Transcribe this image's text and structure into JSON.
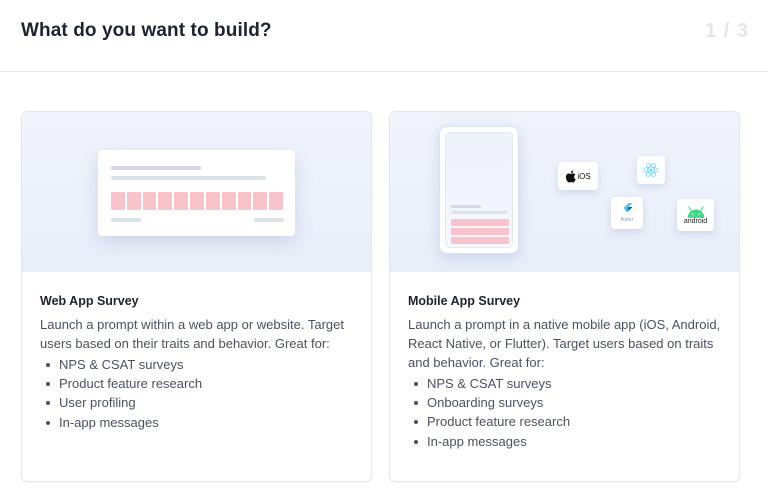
{
  "header": {
    "title": "What do you want to build?",
    "step": "1 / 3"
  },
  "cards": [
    {
      "title": "Web App Survey",
      "description": "Launch a prompt within a web app or website. Target users based on their traits and behavior. Great for:",
      "items": [
        "NPS & CSAT surveys",
        "Product feature research",
        "User profiling",
        "In-app messages"
      ]
    },
    {
      "title": "Mobile App Survey",
      "description": "Launch a prompt in a native mobile app (iOS, Android, React Native, or Flutter). Target users based on traits and behavior. Great for:",
      "items": [
        "NPS & CSAT surveys",
        "Onboarding surveys",
        "Product feature research",
        "In-app messages"
      ]
    }
  ],
  "platforms": {
    "ios": "iOS",
    "flutter": "flutter",
    "android": "android"
  },
  "colors": {
    "accent_pink": "#f8c3ca",
    "illustration_bg": "#eef2fb",
    "android_green": "#3ddc84",
    "react_blue": "#61dafb",
    "flutter_blue": "#42a5f5"
  },
  "icons": {
    "ios": "apple-icon",
    "react": "react-icon",
    "flutter": "flutter-icon",
    "android": "android-icon"
  }
}
